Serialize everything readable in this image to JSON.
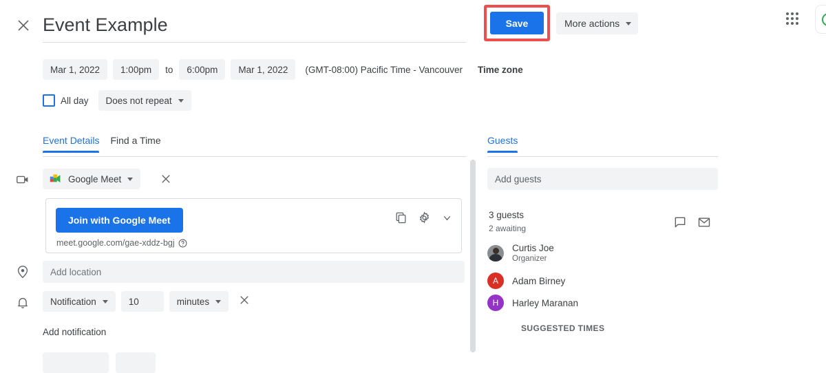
{
  "header": {
    "close_icon": "close-icon",
    "title": "Event Example",
    "save_label": "Save",
    "more_actions_label": "More actions",
    "apps_grid_icon": "apps-grid-icon",
    "account_avatar_icon": "account-avatar"
  },
  "schedule": {
    "start_date": "Mar 1, 2022",
    "start_time": "1:00pm",
    "to_label": "to",
    "end_time": "6:00pm",
    "end_date": "Mar 1, 2022",
    "timezone_text": "(GMT-08:00) Pacific Time - Vancouver",
    "timezone_button": "Time zone",
    "all_day_label": "All day",
    "all_day_checked": false,
    "repeat_label": "Does not repeat"
  },
  "tabs": {
    "left": [
      {
        "label": "Event Details",
        "active": true
      },
      {
        "label": "Find a Time",
        "active": false
      }
    ],
    "right": [
      {
        "label": "Guests",
        "active": true
      }
    ]
  },
  "conference": {
    "row_icon": "video-camera-icon",
    "provider_label": "Google Meet",
    "provider_logo_icon": "google-meet-logo",
    "remove_icon": "close-icon",
    "join_label": "Join with Google Meet",
    "meet_link": "meet.google.com/gae-xddz-bgj",
    "help_icon": "help-circle-icon",
    "copy_icon": "copy-icon",
    "settings_icon": "gear-icon",
    "expand_icon": "chevron-down-icon"
  },
  "location": {
    "row_icon": "location-pin-icon",
    "placeholder": "Add location",
    "value": ""
  },
  "notification": {
    "row_icon": "bell-icon",
    "type_label": "Notification",
    "amount": "10",
    "unit_label": "minutes",
    "remove_icon": "close-icon",
    "add_label": "Add notification"
  },
  "guests": {
    "add_placeholder": "Add guests",
    "add_value": "",
    "count_label": "3 guests",
    "awaiting_label": "2 awaiting",
    "chat_icon": "chat-bubble-icon",
    "email_icon": "envelope-icon",
    "list": [
      {
        "name": "Curtis Joe",
        "role": "Organizer",
        "avatar_type": "photo",
        "avatar_initial": "",
        "avatar_color": "#8a8d91",
        "mark_optional_icon": "person-icon",
        "remove_icon": "close-icon"
      },
      {
        "name": "Adam Birney",
        "role": "",
        "avatar_type": "initial",
        "avatar_initial": "A",
        "avatar_color": "#d93025"
      },
      {
        "name": "Harley Maranan",
        "role": "",
        "avatar_type": "initial",
        "avatar_initial": "H",
        "avatar_color": "#9334c6"
      }
    ],
    "suggested_times_label": "SUGGESTED TIMES"
  },
  "colors": {
    "accent_blue": "#1a73e8",
    "highlight_red": "#ef4e4e",
    "pill_grey": "#f1f3f4",
    "text_primary": "#3c4043",
    "text_secondary": "#5f6368",
    "border": "#dadce0"
  }
}
